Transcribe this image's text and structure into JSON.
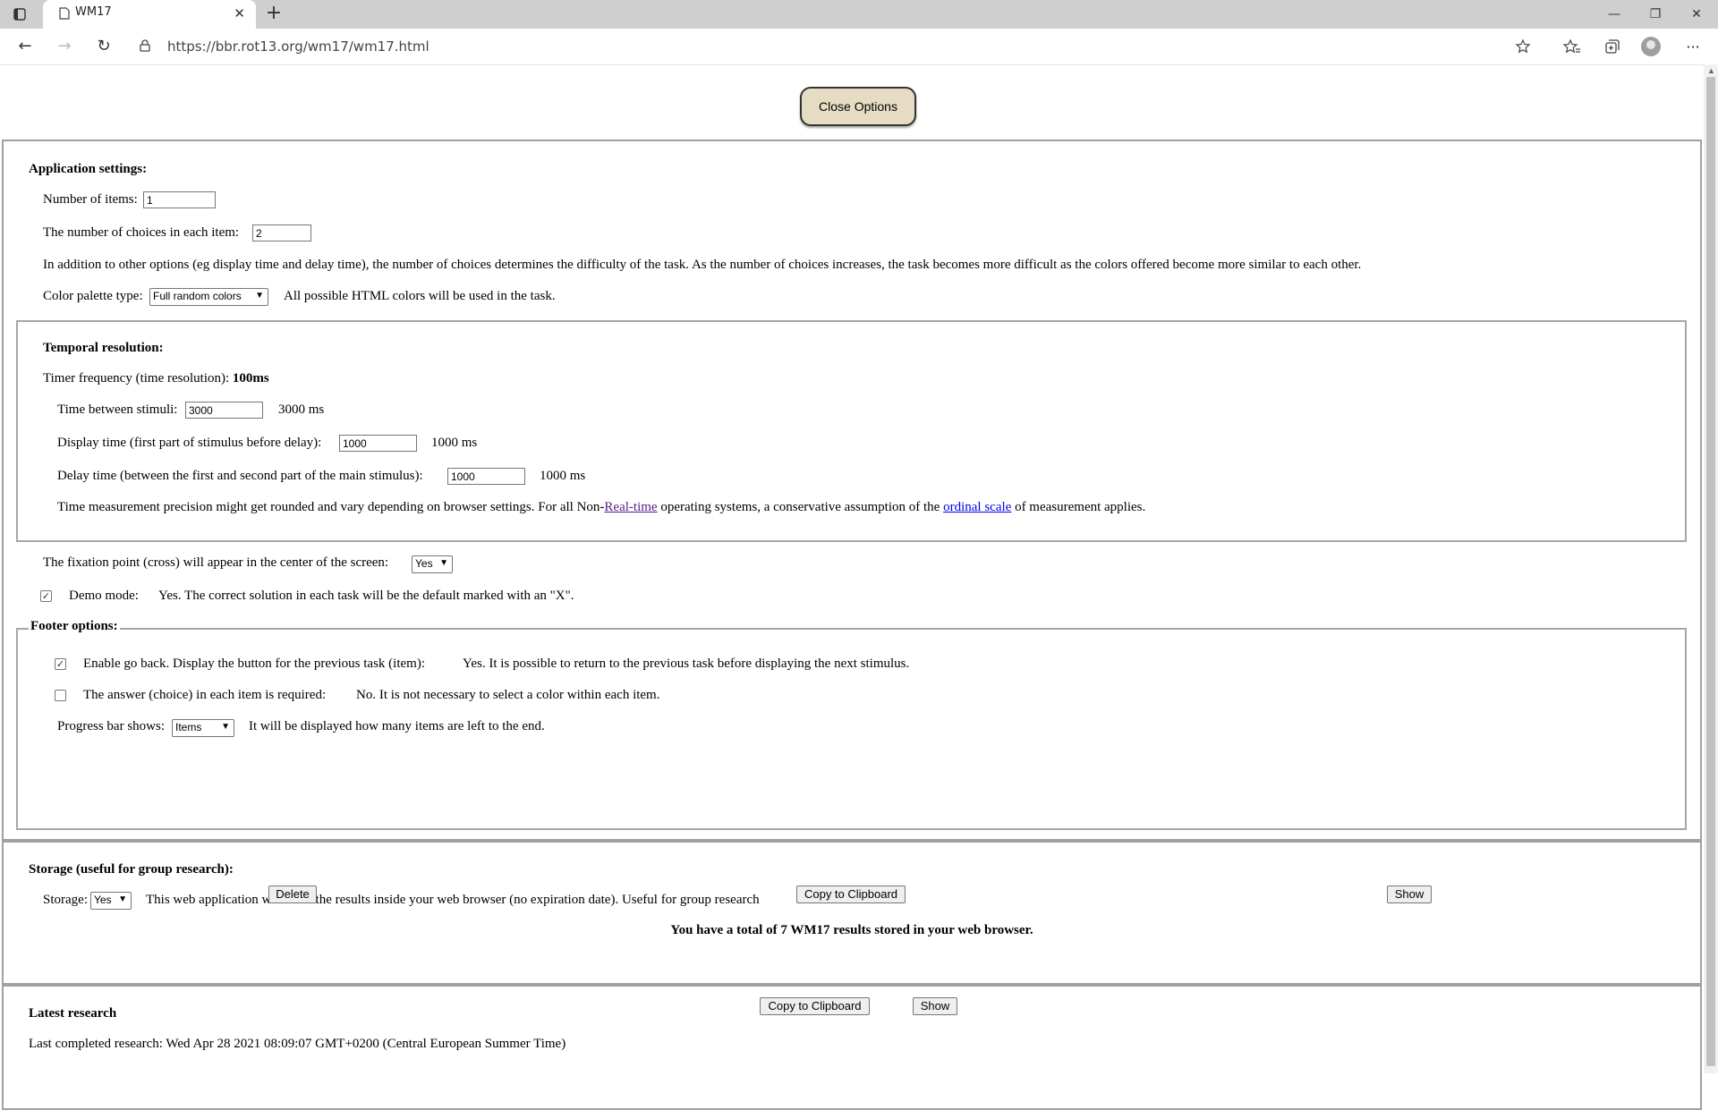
{
  "browser": {
    "tab_title": "WM17",
    "url": "https://bbr.rot13.org/wm17/wm17.html",
    "new_tab_icon": "plus-icon",
    "close_tab_icon": "close-icon"
  },
  "page": {
    "close_options_label": "Close Options",
    "app_settings": {
      "heading": "Application settings:",
      "num_items_label": "Number of items:",
      "num_items_value": "1",
      "num_choices_label": "The number of choices in each item:",
      "num_choices_value": "2",
      "difficulty_note": "In addition to other options (eg display time and delay time), the number of choices determines the difficulty of the task. As the number of choices increases, the task becomes more difficult as the colors offered become more similar to each other.",
      "palette_label": "Color palette type:",
      "palette_value": "Full random colors",
      "palette_note": "All possible HTML colors will be used in the task."
    },
    "temporal": {
      "heading": "Temporal resolution:",
      "timer_label": "Timer frequency (time resolution): ",
      "timer_value": "100ms",
      "between_label": "Time between stimuli:",
      "between_value": "3000",
      "between_display": "3000 ms",
      "display_label": "Display time (first part of stimulus before delay):",
      "display_value": "1000",
      "display_display": "1000 ms",
      "delay_label": "Delay time (between the first and second part of the main stimulus):",
      "delay_value": "1000",
      "delay_display": "1000 ms",
      "precision_pre": "Time measurement precision might get rounded and vary depending on browser settings. For all Non-",
      "precision_link1": "Real-time",
      "precision_mid": " operating systems, a conservative assumption of the ",
      "precision_link2": "ordinal scale",
      "precision_post": " of measurement applies."
    },
    "fixation": {
      "label": "The fixation point (cross) will appear in the center of the screen:",
      "value": "Yes"
    },
    "demo": {
      "checked": true,
      "label": "Demo mode:",
      "note": "Yes. The correct solution in each task will be the default marked with an \"X\"."
    },
    "footer": {
      "legend": "Footer options:",
      "go_back_checked": true,
      "go_back_label": "Enable go back. Display the button for the previous task (item):",
      "go_back_note": "Yes. It is possible to return to the previous task before displaying the next stimulus.",
      "required_checked": false,
      "required_label": "The answer (choice) in each item is required:",
      "required_note": "No. It is not necessary to select a color within each item.",
      "progress_label": "Progress bar shows:",
      "progress_value": "Items",
      "progress_note": "It will be displayed how many items are left to the end."
    },
    "storage": {
      "heading": "Storage (useful for group research):",
      "label": "Storage:",
      "value": "Yes",
      "note": "This web application will store the results inside your web browser (no expiration date). Useful for group research",
      "total": "You have a total of 7 WM17 results stored in your web browser.",
      "delete_label": "Delete",
      "copy_label": "Copy to Clipboard",
      "show_label": "Show"
    },
    "latest": {
      "heading": "Latest research",
      "completed": "Last completed research: Wed Apr 28 2021 08:09:07 GMT+0200 (Central European Summer Time)",
      "copy_label": "Copy to Clipboard",
      "show_label": "Show"
    }
  }
}
